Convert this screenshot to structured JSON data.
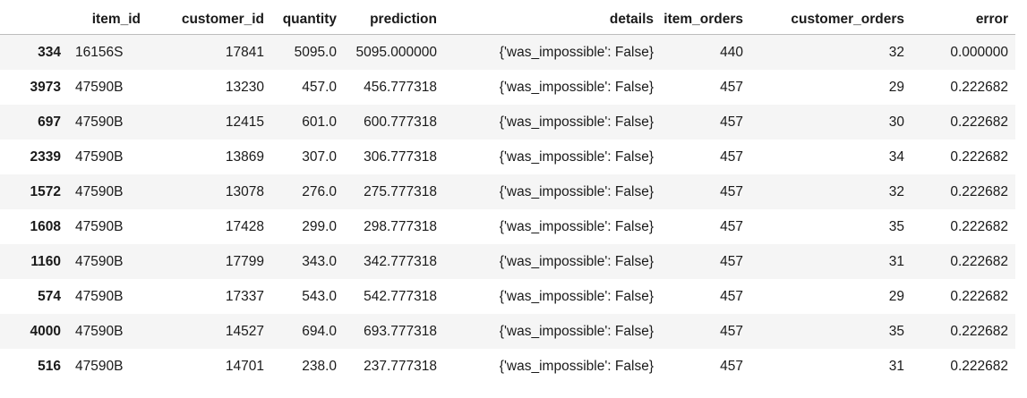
{
  "columns": {
    "index": "",
    "item_id": "item_id",
    "customer_id": "customer_id",
    "quantity": "quantity",
    "prediction": "prediction",
    "details": "details",
    "item_orders": "item_orders",
    "customer_orders": "customer_orders",
    "error": "error"
  },
  "rows": [
    {
      "index": "334",
      "item_id": "16156S",
      "customer_id": "17841",
      "quantity": "5095.0",
      "prediction": "5095.000000",
      "details": "{'was_impossible': False}",
      "item_orders": "440",
      "customer_orders": "32",
      "error": "0.000000"
    },
    {
      "index": "3973",
      "item_id": "47590B",
      "customer_id": "13230",
      "quantity": "457.0",
      "prediction": "456.777318",
      "details": "{'was_impossible': False}",
      "item_orders": "457",
      "customer_orders": "29",
      "error": "0.222682"
    },
    {
      "index": "697",
      "item_id": "47590B",
      "customer_id": "12415",
      "quantity": "601.0",
      "prediction": "600.777318",
      "details": "{'was_impossible': False}",
      "item_orders": "457",
      "customer_orders": "30",
      "error": "0.222682"
    },
    {
      "index": "2339",
      "item_id": "47590B",
      "customer_id": "13869",
      "quantity": "307.0",
      "prediction": "306.777318",
      "details": "{'was_impossible': False}",
      "item_orders": "457",
      "customer_orders": "34",
      "error": "0.222682"
    },
    {
      "index": "1572",
      "item_id": "47590B",
      "customer_id": "13078",
      "quantity": "276.0",
      "prediction": "275.777318",
      "details": "{'was_impossible': False}",
      "item_orders": "457",
      "customer_orders": "32",
      "error": "0.222682"
    },
    {
      "index": "1608",
      "item_id": "47590B",
      "customer_id": "17428",
      "quantity": "299.0",
      "prediction": "298.777318",
      "details": "{'was_impossible': False}",
      "item_orders": "457",
      "customer_orders": "35",
      "error": "0.222682"
    },
    {
      "index": "1160",
      "item_id": "47590B",
      "customer_id": "17799",
      "quantity": "343.0",
      "prediction": "342.777318",
      "details": "{'was_impossible': False}",
      "item_orders": "457",
      "customer_orders": "31",
      "error": "0.222682"
    },
    {
      "index": "574",
      "item_id": "47590B",
      "customer_id": "17337",
      "quantity": "543.0",
      "prediction": "542.777318",
      "details": "{'was_impossible': False}",
      "item_orders": "457",
      "customer_orders": "29",
      "error": "0.222682"
    },
    {
      "index": "4000",
      "item_id": "47590B",
      "customer_id": "14527",
      "quantity": "694.0",
      "prediction": "693.777318",
      "details": "{'was_impossible': False}",
      "item_orders": "457",
      "customer_orders": "35",
      "error": "0.222682"
    },
    {
      "index": "516",
      "item_id": "47590B",
      "customer_id": "14701",
      "quantity": "238.0",
      "prediction": "237.777318",
      "details": "{'was_impossible': False}",
      "item_orders": "457",
      "customer_orders": "31",
      "error": "0.222682"
    }
  ]
}
